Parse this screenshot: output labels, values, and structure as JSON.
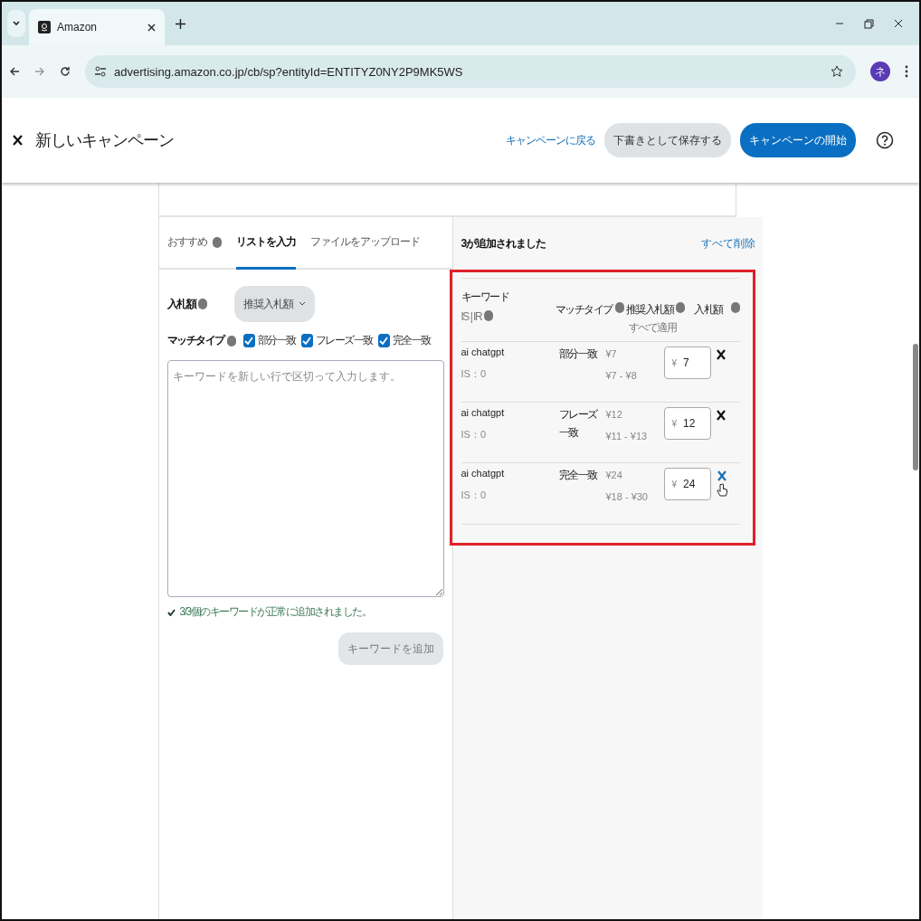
{
  "browser": {
    "tab_title": "Amazon",
    "url": "advertising.amazon.co.jp/cb/sp?entityId=ENTITYZ0NY2P9MK5WS",
    "profile_initial": "ネ"
  },
  "header": {
    "title": "新しいキャンペーン",
    "back_link": "キャンペーンに戻る",
    "save_draft": "下書きとして保存する",
    "launch": "キャンペーンの開始"
  },
  "tabs": [
    {
      "label": "おすすめ",
      "info": true,
      "selected": false
    },
    {
      "label": "リストを入力",
      "info": false,
      "selected": true
    },
    {
      "label": "ファイルをアップロード",
      "info": false,
      "selected": false
    }
  ],
  "bid": {
    "label": "入札額",
    "dropdown": "推奨入札額"
  },
  "match_type": {
    "label": "マッチタイプ",
    "options": [
      {
        "label": "部分一致",
        "checked": true
      },
      {
        "label": "フレーズ一致",
        "checked": true
      },
      {
        "label": "完全一致",
        "checked": true
      }
    ]
  },
  "keyword_input": {
    "placeholder": "キーワードを新しい行で区切って入力します。"
  },
  "success_message": "3/3個のキーワードが正常に追加されました。",
  "add_button": "キーワードを追加",
  "added": {
    "title": "3が追加されました",
    "remove_all": "すべて削除",
    "columns": {
      "keyword": "キーワード",
      "is_ir": "IS | IR",
      "match_type": "マッチタイプ",
      "suggested_bid": "推奨入札額",
      "apply_all": "すべて適用",
      "bid": "入札額"
    },
    "rows": [
      {
        "keyword": "ai chatgpt",
        "is": "IS：0",
        "match_type": "部分一致",
        "suggested": "¥7",
        "range": "¥7 - ¥8",
        "currency": "¥",
        "bid": "7",
        "hovered": false
      },
      {
        "keyword": "ai chatgpt",
        "is": "IS：0",
        "match_type": "フレーズ一致",
        "suggested": "¥12",
        "range": "¥11 - ¥13",
        "currency": "¥",
        "bid": "12",
        "hovered": false
      },
      {
        "keyword": "ai chatgpt",
        "is": "IS：0",
        "match_type": "完全一致",
        "suggested": "¥24",
        "range": "¥18 - ¥30",
        "currency": "¥",
        "bid": "24",
        "hovered": true
      }
    ]
  }
}
